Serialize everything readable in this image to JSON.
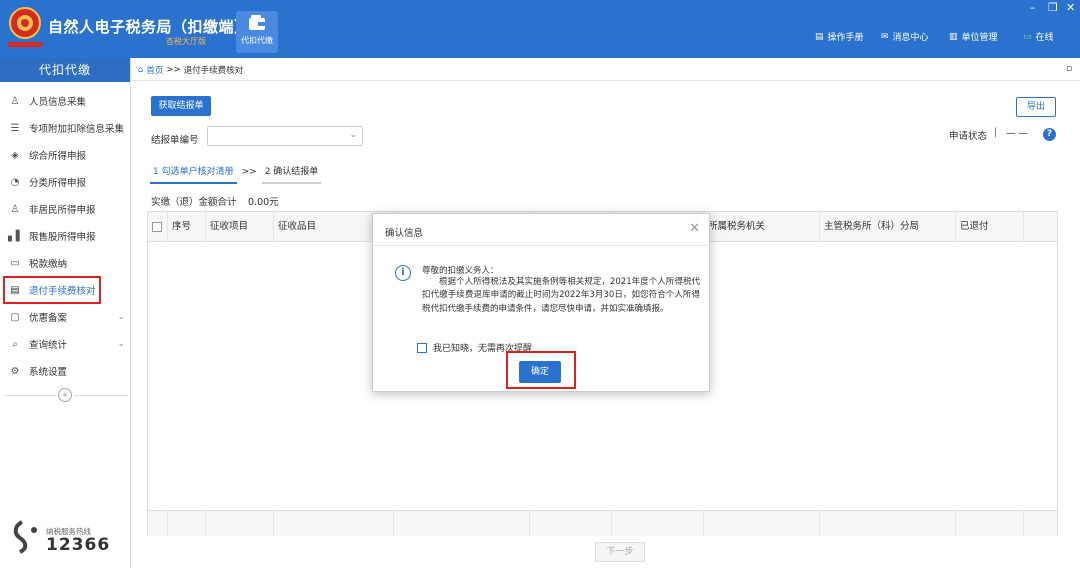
{
  "app": {
    "title": "自然人电子税务局（扣缴端）",
    "subtitle": "杏税大厅版",
    "module_label": "代扣代缴"
  },
  "top_right": {
    "manual": "操作手册",
    "messages": "消息中心",
    "unit": "单位管理",
    "online": "在线"
  },
  "sidebar": {
    "header": "代扣代缴",
    "items": [
      {
        "label": "人员信息采集",
        "icon": "person-icon"
      },
      {
        "label": "专项附加扣除信息采集",
        "icon": "list-icon"
      },
      {
        "label": "综合所得申报",
        "icon": "layers-icon"
      },
      {
        "label": "分类所得申报",
        "icon": "pie-icon"
      },
      {
        "label": "非居民所得申报",
        "icon": "person-icon"
      },
      {
        "label": "限售股所得申报",
        "icon": "bar-icon"
      },
      {
        "label": "税款缴纳",
        "icon": "folder-icon"
      },
      {
        "label": "退付手续费核对",
        "icon": "doc-icon"
      },
      {
        "label": "优惠备案",
        "icon": "doc-icon"
      },
      {
        "label": "查询统计",
        "icon": "search-icon"
      },
      {
        "label": "系统设置",
        "icon": "gear-icon"
      }
    ],
    "hotline_label": "纳税服务热线",
    "hotline_number": "12366"
  },
  "breadcrumb": {
    "home": "首页",
    "separator": ">>",
    "current": "退付手续费核对"
  },
  "main": {
    "get_report_button": "获取结报单",
    "export_button": "导出",
    "report_no_label": "结报单编号",
    "status_label": "申请状态",
    "status_value": "— —",
    "steps": [
      "1 勾选单户核对清册",
      "2 确认结报单"
    ],
    "step_separator": ">>",
    "total_label": "实缴（退）金额合计",
    "total_value": "0.00元",
    "columns": [
      "序号",
      "征收项目",
      "征收品目",
      "所属税务机关",
      "主管税务所（科）分局",
      "已退付"
    ],
    "next_button": "下一步"
  },
  "modal": {
    "title": "确认信息",
    "greeting": "尊敬的扣缴义务人：",
    "body": "根据个人所得税法及其实施条例等相关规定，2021年度个人所得税代扣代缴手续费退库申请的截止时间为2022年3月30日，如您符合个人所得税代扣代缴手续费的申请条件，请您尽快申请，并如实准确填报。",
    "checkbox_label": "我已知晓，无需再次提醒",
    "ok_button": "确定"
  },
  "colors": {
    "brand": "#2b72cf",
    "highlight": "#e02020",
    "subtitle": "#f6b84c"
  }
}
